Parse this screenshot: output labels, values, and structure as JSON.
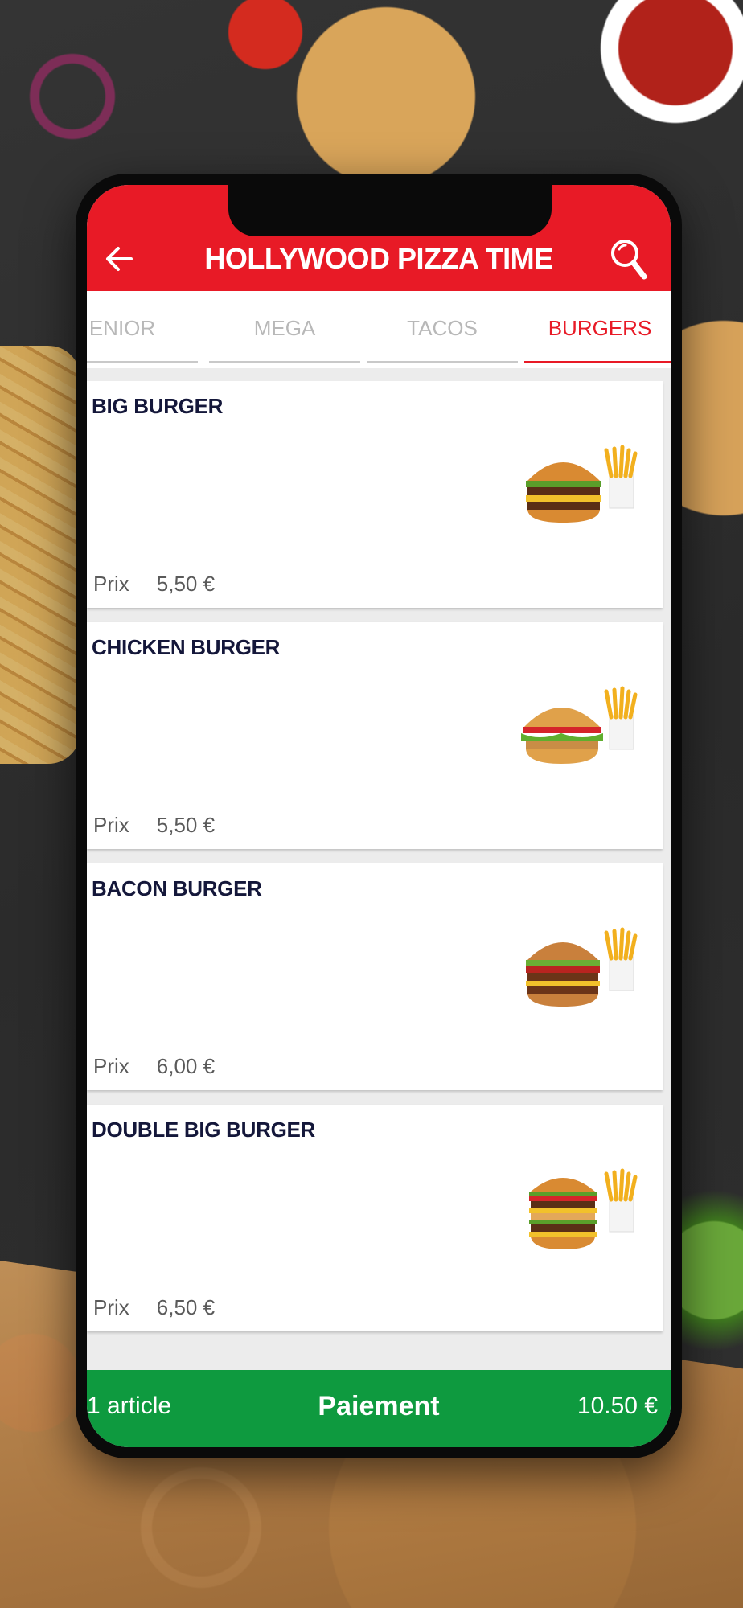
{
  "header": {
    "title": "HOLLYWOOD PIZZA TIME"
  },
  "tabs": [
    {
      "label": "ENIOR",
      "active": false
    },
    {
      "label": "MEGA",
      "active": false
    },
    {
      "label": "TACOS",
      "active": false
    },
    {
      "label": "BURGERS",
      "active": true
    }
  ],
  "products": [
    {
      "name": "BIG BURGER",
      "price_label": "Prix",
      "price": "5,50 €"
    },
    {
      "name": "CHICKEN BURGER",
      "price_label": "Prix",
      "price": "5,50 €"
    },
    {
      "name": "BACON BURGER",
      "price_label": "Prix",
      "price": "6,00 €"
    },
    {
      "name": "DOUBLE BIG BURGER",
      "price_label": "Prix",
      "price": "6,50 €"
    }
  ],
  "cart": {
    "count_text": "1 article",
    "checkout_label": "Paiement",
    "total": "10.50 €"
  },
  "colors": {
    "brand_red": "#e81a26",
    "checkout_green": "#0e9a3f",
    "title_navy": "#14173a"
  }
}
